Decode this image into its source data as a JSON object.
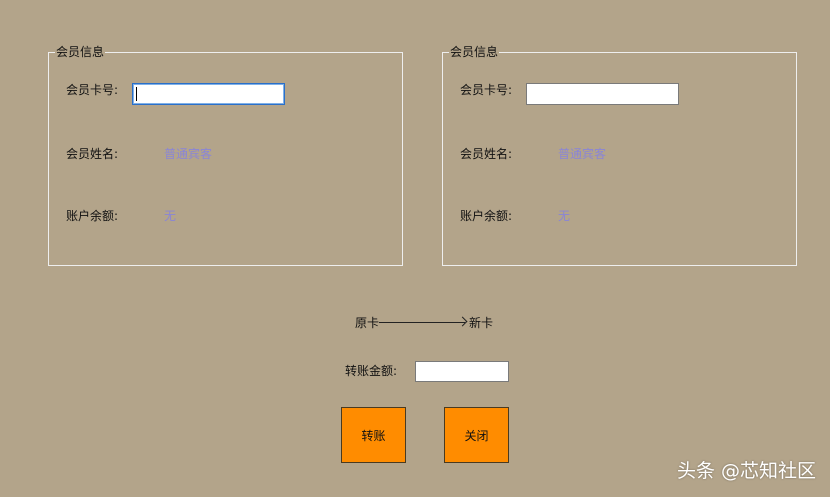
{
  "left_panel": {
    "title": "会员信息",
    "card_label": "会员卡号:",
    "card_value": "",
    "name_label": "会员姓名:",
    "name_value": "普通宾客",
    "balance_label": "账户余额:",
    "balance_value": "无"
  },
  "right_panel": {
    "title": "会员信息",
    "card_label": "会员卡号:",
    "card_value": "",
    "name_label": "会员姓名:",
    "name_value": "普通宾客",
    "balance_label": "账户余额:",
    "balance_value": "无"
  },
  "transfer": {
    "from_label": "原卡",
    "to_label": "新卡",
    "amount_label": "转账金额:",
    "amount_value": "",
    "transfer_button": "转账",
    "close_button": "关闭"
  },
  "watermark": "头条 @芯知社区",
  "colors": {
    "background": "#b3a48a",
    "value_text": "#8a85d6",
    "button": "#ff8c00"
  }
}
